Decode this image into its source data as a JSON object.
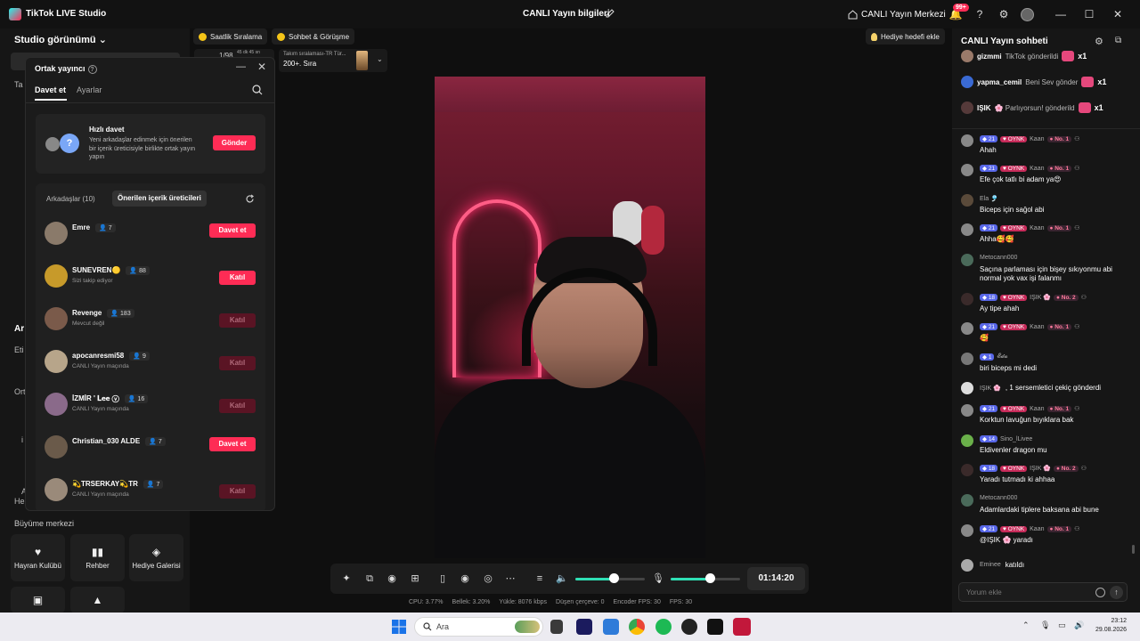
{
  "titlebar": {
    "app_name": "TikTok LIVE Studio",
    "live_info": "CANLI Yayın bilgileri",
    "live_center": "CANLI Yayın Merkezi",
    "notif_badge": "99+"
  },
  "left": {
    "studio_view": "Studio görünümü",
    "frag_ta": "Ta",
    "frag_ar": "Ar",
    "frag_eti": "Eti",
    "frag_ort": "Ort",
    "frag_i": "i",
    "frag_a": "A",
    "frag_he": "He",
    "growth_title": "Büyüme merkezi",
    "tiles": [
      {
        "label": "Hayran Kulübü",
        "icon": "heart-shield-icon"
      },
      {
        "label": "Rehber",
        "icon": "book-icon"
      },
      {
        "label": "Hediye Galerisi",
        "icon": "gift-gallery-icon"
      }
    ]
  },
  "topbar": {
    "hourly_ranking": "Saatlik Sıralama",
    "chat_meet": "Sohbet & Görüşme",
    "timer_partial": "1/98",
    "timer_partial2": "45 dk 45 sn",
    "rank_small": "Takım sıralaması-TR Tür...",
    "rank_big": "200+. Sıra",
    "gift_goal": "Hediye hedefi ekle"
  },
  "popup": {
    "title": "Ortak yayıncı",
    "tab_invite": "Davet et",
    "tab_settings": "Ayarlar",
    "quick_title": "Hızlı davet",
    "quick_desc": "Yeni arkadaşlar edinmek için önerilen bir içerik üreticisiyle birlikte ortak yayın yapın",
    "quick_button": "Gönder",
    "friends_tab": "Arkadaşlar (10)",
    "suggested_tab": "Önerilen içerik üreticileri",
    "rows": [
      {
        "name": "Emre",
        "count": "7",
        "sub": "",
        "button": "Davet et",
        "active": true,
        "color": "#8a7a6a"
      },
      {
        "name": "SUNEVREN🟡",
        "count": "88",
        "sub": "Sizi takip ediyor",
        "button": "Katıl",
        "active": true,
        "color": "#c79a2a"
      },
      {
        "name": "Revenge",
        "count": "183",
        "sub": "Mevcut değil",
        "button": "Katıl",
        "active": false,
        "color": "#7a5a4a"
      },
      {
        "name": "apocanresmi58",
        "count": "9",
        "sub": "CANLI Yayın maçında",
        "button": "Katıl",
        "active": false,
        "color": "#b7a58a"
      },
      {
        "name": "İZMİR ' 𝐋𝐞𝐞 ⓥ",
        "count": "16",
        "sub": "CANLI Yayın maçında",
        "button": "Katıl",
        "active": false,
        "color": "#8a6a8a"
      },
      {
        "name": "Christian_030 ALDE",
        "count": "7",
        "sub": "",
        "button": "Davet et",
        "active": true,
        "color": "#6a5a4a"
      },
      {
        "name": "💫TRSERKAY💫TR",
        "count": "7",
        "sub": "CANLI Yayın maçında",
        "button": "Katıl",
        "active": false,
        "color": "#9a8a7a"
      }
    ]
  },
  "controls": {
    "timer": "01:14:20"
  },
  "stats": {
    "cpu": "CPU:  3.77%",
    "memory": "Bellek:  3.20%",
    "upload": "Yükle:  8076 kbps",
    "dropped": "Düşen çerçeve:  0",
    "encoder_fps": "Encoder FPS:  30",
    "fps": "FPS:  30"
  },
  "chat": {
    "title": "CANLI Yayın sohbeti",
    "gifts": [
      {
        "user": "gizmmi",
        "text": "TikTok gönderildi",
        "mult": "x1"
      },
      {
        "user": "yapma_cemil",
        "text": "Beni Sev gönder",
        "mult": "x1"
      },
      {
        "user": "IŞIK",
        "text": "🌸 Parlıyorsun! gönderild",
        "mult": "x1"
      }
    ],
    "messages": [
      {
        "lv": "21",
        "fan": "OYNK",
        "user": "Kaan",
        "no": "No. 1",
        "text": "Ahah"
      },
      {
        "lv": "21",
        "fan": "OYNK",
        "user": "Kaan",
        "no": "No. 1",
        "text": "Efe çok tatlı bi adam ya😍"
      },
      {
        "lv": "",
        "fan": "",
        "user": "Ela 🎐",
        "no": "",
        "text": "Biceps için sağol abi"
      },
      {
        "lv": "21",
        "fan": "OYNK",
        "user": "Kaan",
        "no": "No. 1",
        "text": "Ahha🥰🥰"
      },
      {
        "lv": "",
        "fan": "",
        "user": "Metocann000",
        "no": "",
        "text": "Saçına parlaması için bişey sıkıyonmu abi normal yok vax işi falanmı"
      },
      {
        "lv": "18",
        "fan": "OYNK",
        "user": "IŞIK 🌸",
        "no": "No. 2",
        "text": "Ay tipe ahah"
      },
      {
        "lv": "21",
        "fan": "OYNK",
        "user": "Kaan",
        "no": "No. 1",
        "text": "🥰"
      },
      {
        "lv": "1",
        "fan": "",
        "user": "𝓔𝓭𝓪",
        "no": "",
        "text": "biri biceps mi dedi"
      },
      {
        "lv": "",
        "fan": "",
        "user": "IŞIK 🌸",
        "no": "",
        "text": ", 1 sersemletici çekiç gönderdi"
      },
      {
        "lv": "21",
        "fan": "OYNK",
        "user": "Kaan",
        "no": "No. 1",
        "text": "Korktun lavuğun bıyıklara bak"
      },
      {
        "lv": "14",
        "fan": "",
        "user": "Sino_lLivee",
        "no": "",
        "text": "Eldivenler dragon mu"
      },
      {
        "lv": "18",
        "fan": "OYNK",
        "user": "IŞIK 🌸",
        "no": "No. 2",
        "text": "Yaradı tutmadı ki ahhaa"
      },
      {
        "lv": "",
        "fan": "",
        "user": "Metocann000",
        "no": "",
        "text": "Adamlardaki tiplere baksana abi bune"
      },
      {
        "lv": "21",
        "fan": "OYNK",
        "user": "Kaan",
        "no": "No. 1",
        "text": "@IŞIK 🌸 yaradı"
      },
      {
        "lv": "",
        "fan": "",
        "user": "Eminee",
        "no": "",
        "text": "katıldı"
      }
    ],
    "input_placeholder": "Yorum ekle"
  },
  "taskbar": {
    "search": "Ara",
    "time": "23:12",
    "date": "29.08.2026"
  }
}
